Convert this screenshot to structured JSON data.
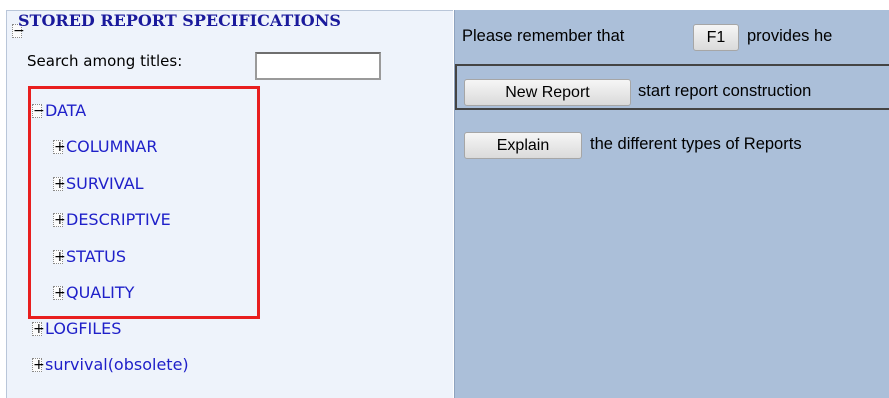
{
  "panel": {
    "title": "STORED REPORT SPECIFICATIONS",
    "title_toggle": "−",
    "search_label": "Search among titles:",
    "search_value": "",
    "search_placeholder": ""
  },
  "tree": {
    "data": {
      "toggle": "−",
      "label": "DATA"
    },
    "children": [
      {
        "toggle": "+",
        "label": "COLUMNAR"
      },
      {
        "toggle": "+",
        "label": "SURVIVAL"
      },
      {
        "toggle": "+",
        "label": "DESCRIPTIVE"
      },
      {
        "toggle": "+",
        "label": "STATUS"
      },
      {
        "toggle": "+",
        "label": "QUALITY"
      }
    ],
    "others": [
      {
        "toggle": "+",
        "label": "LOGFILES"
      },
      {
        "toggle": "+",
        "label": "survival(obsolete)"
      }
    ]
  },
  "right": {
    "reminder_prefix": "Please remember that",
    "f1_label": "F1",
    "reminder_suffix": "provides he",
    "new_report_label": "New Report",
    "new_report_text": "start report construction",
    "explain_label": "Explain",
    "explain_text": "the different types of Reports"
  },
  "colors": {
    "highlight": "#e81e1e",
    "link": "#1f20c9",
    "title": "#1a1a9c",
    "right_bg": "#abbfd9",
    "left_bg": "#eef3fb"
  }
}
